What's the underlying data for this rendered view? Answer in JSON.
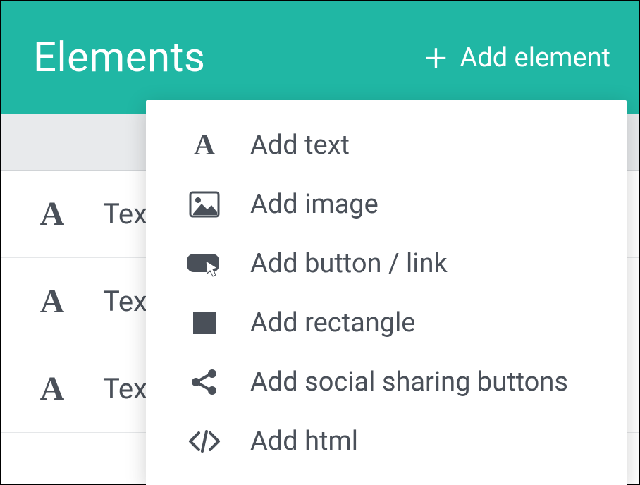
{
  "header": {
    "title": "Elements",
    "add_button_label": "Add element"
  },
  "list": {
    "items": [
      {
        "label": "Tex"
      },
      {
        "label": "Tex"
      },
      {
        "label": "Tex"
      }
    ]
  },
  "dropdown": {
    "items": [
      {
        "icon": "text-icon",
        "label": "Add text"
      },
      {
        "icon": "image-icon",
        "label": "Add image"
      },
      {
        "icon": "button-icon",
        "label": "Add button / link"
      },
      {
        "icon": "rectangle-icon",
        "label": "Add rectangle"
      },
      {
        "icon": "share-icon",
        "label": "Add social sharing buttons"
      },
      {
        "icon": "html-icon",
        "label": "Add html"
      }
    ]
  },
  "colors": {
    "accent": "#20b7a4",
    "text": "#4a5059"
  }
}
